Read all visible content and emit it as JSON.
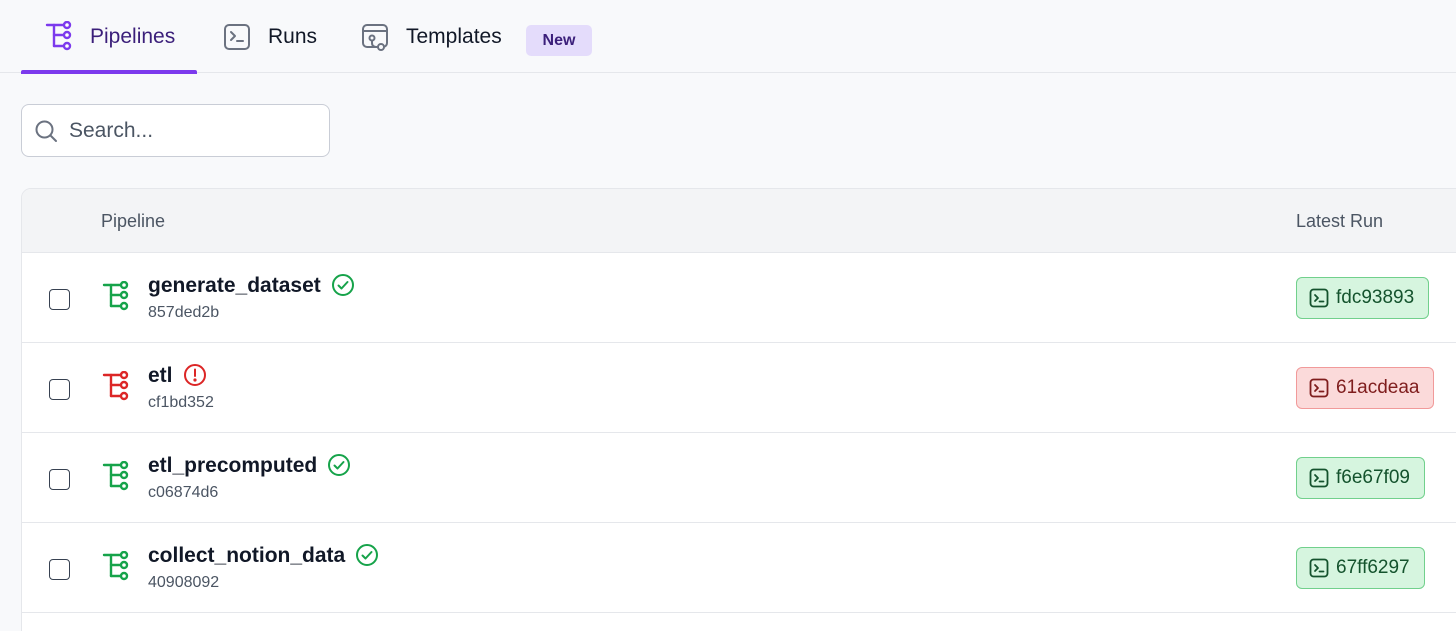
{
  "tabs": {
    "pipelines": "Pipelines",
    "runs": "Runs",
    "templates": "Templates",
    "templates_badge": "New"
  },
  "search": {
    "placeholder": "Search..."
  },
  "table": {
    "headers": {
      "pipeline": "Pipeline",
      "latest_run": "Latest Run"
    },
    "rows": [
      {
        "name": "generate_dataset",
        "id": "857ded2b",
        "status": "success",
        "run": "fdc93893"
      },
      {
        "name": "etl",
        "id": "cf1bd352",
        "status": "failed",
        "run": "61acdeaa"
      },
      {
        "name": "etl_precomputed",
        "id": "c06874d6",
        "status": "success",
        "run": "f6e67f09"
      },
      {
        "name": "collect_notion_data",
        "id": "40908092",
        "status": "success",
        "run": "67ff6297"
      }
    ]
  },
  "colors": {
    "accent": "#7c3aed",
    "success": "#16a34a",
    "failed": "#dc2626"
  }
}
